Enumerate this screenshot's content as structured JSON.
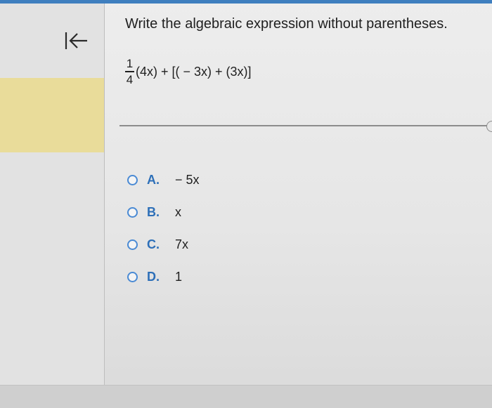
{
  "colors": {
    "accent_blue": "#2d6fb8",
    "radio_border": "#4a8ad4",
    "highlight_yellow": "#e9dc9a",
    "text": "#1f1f1f"
  },
  "nav": {
    "back_icon": "first-page-icon"
  },
  "question": {
    "prompt": "Write the algebraic expression without parentheses.",
    "expression": {
      "fraction_numerator": "1",
      "fraction_denominator": "4",
      "remainder": "(4x) + [( − 3x) + (3x)]"
    }
  },
  "options": [
    {
      "letter": "A.",
      "text": "− 5x"
    },
    {
      "letter": "B.",
      "text": "x"
    },
    {
      "letter": "C.",
      "text": "7x"
    },
    {
      "letter": "D.",
      "text": "1"
    }
  ]
}
